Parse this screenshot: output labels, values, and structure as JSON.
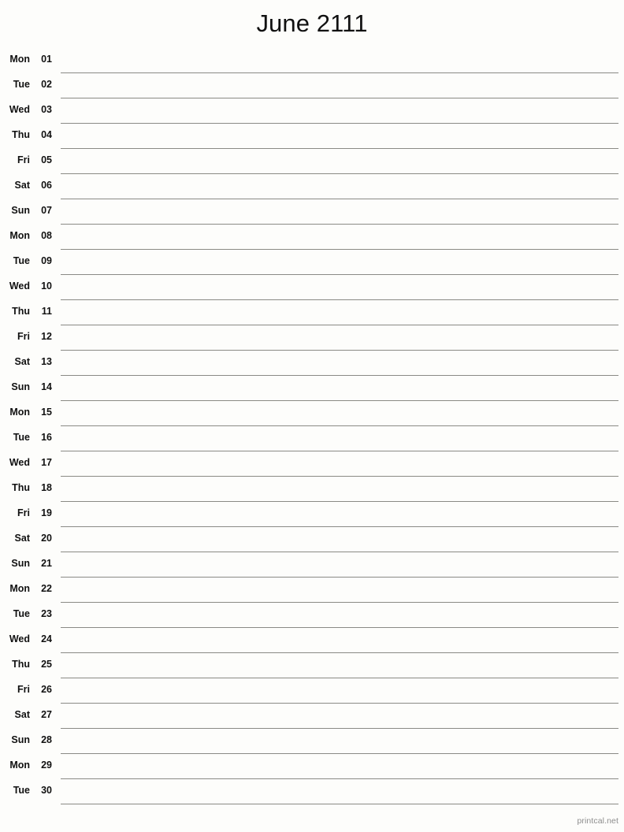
{
  "page": {
    "title": "June 2111",
    "footer_credit": "printcal.net",
    "background_color": "#fdfdfb",
    "rule_color": "#8a8a85",
    "text_color": "#111111",
    "footer_color": "#8d8d8d"
  },
  "days": [
    {
      "weekday": "Mon",
      "number": "01"
    },
    {
      "weekday": "Tue",
      "number": "02"
    },
    {
      "weekday": "Wed",
      "number": "03"
    },
    {
      "weekday": "Thu",
      "number": "04"
    },
    {
      "weekday": "Fri",
      "number": "05"
    },
    {
      "weekday": "Sat",
      "number": "06"
    },
    {
      "weekday": "Sun",
      "number": "07"
    },
    {
      "weekday": "Mon",
      "number": "08"
    },
    {
      "weekday": "Tue",
      "number": "09"
    },
    {
      "weekday": "Wed",
      "number": "10"
    },
    {
      "weekday": "Thu",
      "number": "11"
    },
    {
      "weekday": "Fri",
      "number": "12"
    },
    {
      "weekday": "Sat",
      "number": "13"
    },
    {
      "weekday": "Sun",
      "number": "14"
    },
    {
      "weekday": "Mon",
      "number": "15"
    },
    {
      "weekday": "Tue",
      "number": "16"
    },
    {
      "weekday": "Wed",
      "number": "17"
    },
    {
      "weekday": "Thu",
      "number": "18"
    },
    {
      "weekday": "Fri",
      "number": "19"
    },
    {
      "weekday": "Sat",
      "number": "20"
    },
    {
      "weekday": "Sun",
      "number": "21"
    },
    {
      "weekday": "Mon",
      "number": "22"
    },
    {
      "weekday": "Tue",
      "number": "23"
    },
    {
      "weekday": "Wed",
      "number": "24"
    },
    {
      "weekday": "Thu",
      "number": "25"
    },
    {
      "weekday": "Fri",
      "number": "26"
    },
    {
      "weekday": "Sat",
      "number": "27"
    },
    {
      "weekday": "Sun",
      "number": "28"
    },
    {
      "weekday": "Mon",
      "number": "29"
    },
    {
      "weekday": "Tue",
      "number": "30"
    }
  ]
}
